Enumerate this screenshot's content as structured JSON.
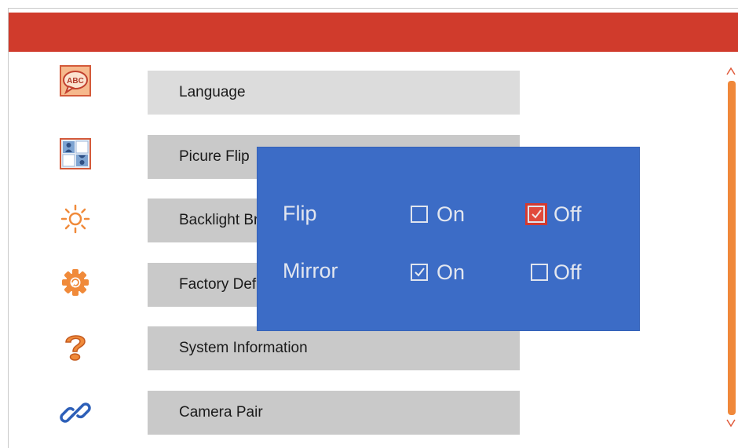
{
  "menu": {
    "items": [
      {
        "label": "Language",
        "icon": "language-abc-icon",
        "selected": true
      },
      {
        "label": "Picure Flip",
        "icon": "picture-flip-icon"
      },
      {
        "label": "Backlight Brightness",
        "icon": "backlight-sun-icon"
      },
      {
        "label": "Factory Default",
        "icon": "factory-default-gear-icon"
      },
      {
        "label": "System Information",
        "icon": "system-info-question-icon"
      },
      {
        "label": "Camera Pair",
        "icon": "camera-pair-link-icon"
      }
    ]
  },
  "flip_dialog": {
    "rows": [
      {
        "label": "Flip",
        "on_label": "On",
        "off_label": "Off",
        "on_checked": false,
        "off_checked": true,
        "highlighted": "off"
      },
      {
        "label": "Mirror",
        "on_label": "On",
        "off_label": "Off",
        "on_checked": true,
        "off_checked": false,
        "highlighted": null
      }
    ]
  },
  "colors": {
    "topbar": "#d03b2c",
    "menu_item_bg": "#c9c9c9",
    "menu_item_selected_bg": "#dcdcdc",
    "dialog_bg": "#3c6cc6",
    "highlight": "#e14a3b",
    "scrollbar": "#f0883a"
  }
}
